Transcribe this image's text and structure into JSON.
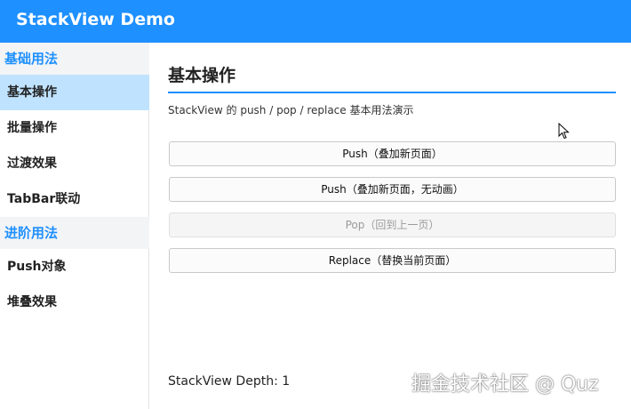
{
  "app": {
    "title": "StackView Demo"
  },
  "sidebar": {
    "groups": [
      {
        "label": "基础用法",
        "items": [
          "基本操作",
          "批量操作",
          "过渡效果",
          "TabBar联动"
        ]
      },
      {
        "label": "进阶用法",
        "items": [
          "Push对象",
          "堆叠效果"
        ]
      }
    ],
    "active_item": "基本操作"
  },
  "main": {
    "title": "基本操作",
    "description": "StackView 的 push / pop / replace 基本用法演示",
    "buttons": [
      {
        "label": "Push（叠加新页面）",
        "enabled": true
      },
      {
        "label": "Push（叠加新页面，无动画）",
        "enabled": true
      },
      {
        "label": "Pop（回到上一页）",
        "enabled": false
      },
      {
        "label": "Replace（替换当前页面）",
        "enabled": true
      }
    ],
    "depth_text": "StackView Depth: 1"
  },
  "watermark": "掘金技术社区 @ Quz",
  "colors": {
    "accent": "#1e90ff",
    "active_item_bg": "#bfe3ff",
    "group_bg": "#f3f4f6"
  }
}
